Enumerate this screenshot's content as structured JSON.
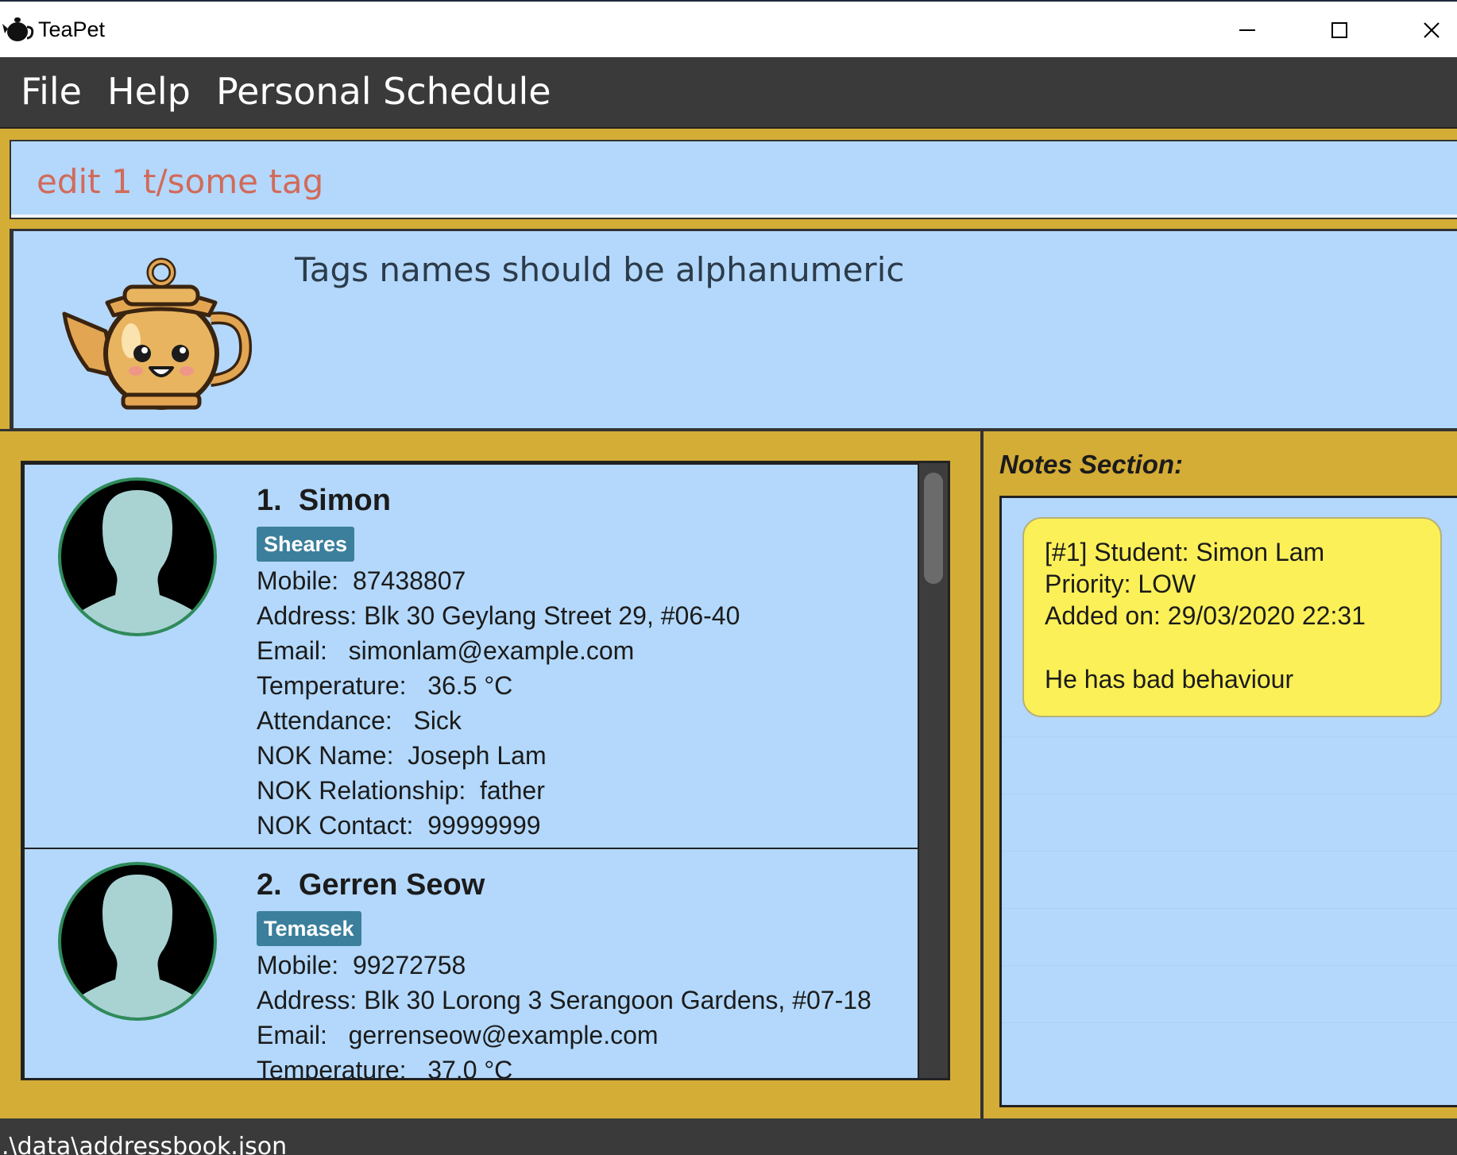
{
  "window": {
    "title": "TeaPet",
    "app_icon": "teapot-icon",
    "controls": [
      "minimize-icon",
      "maximize-icon",
      "close-icon"
    ]
  },
  "menu": {
    "file": "File",
    "help": "Help",
    "schedule": "Personal Schedule"
  },
  "command": {
    "value": "edit 1 t/some tag"
  },
  "result": {
    "message": "Tags names should be alphanumeric",
    "mascot": "teapot-mascot"
  },
  "students": [
    {
      "index": "1.",
      "name": "Simon",
      "tag": "Sheares",
      "mobile": "Mobile:  87438807",
      "address": "Address: Blk 30 Geylang Street 29, #06-40",
      "email": "Email:   simonlam@example.com",
      "temperature": "Temperature:   36.5 °C",
      "attendance": "Attendance:   Sick",
      "nok_name": "NOK Name:  Joseph Lam",
      "nok_relationship": "NOK Relationship:  father",
      "nok_contact": "NOK Contact:  99999999"
    },
    {
      "index": "2.",
      "name": "Gerren Seow",
      "tag": "Temasek",
      "mobile": "Mobile:  99272758",
      "address": "Address: Blk 30 Lorong 3 Serangoon Gardens, #07-18",
      "email": "Email:   gerrenseow@example.com",
      "temperature": "Temperature:   37.0 °C"
    }
  ],
  "notes": {
    "title": "Notes Section:",
    "items": [
      {
        "student": "[#1] Student: Simon Lam",
        "priority": "Priority: LOW",
        "added": "Added on: 29/03/2020 22:31",
        "content": "He has bad behaviour"
      }
    ]
  },
  "status": {
    "path": ".\\data\\addressbook.json"
  },
  "colors": {
    "background": "#d4ad37",
    "panel": "#b3d8fb",
    "menubar": "#3a3a3a",
    "tag": "#3b7f9c",
    "note": "#fcf058",
    "command_text": "#d26a5a"
  }
}
